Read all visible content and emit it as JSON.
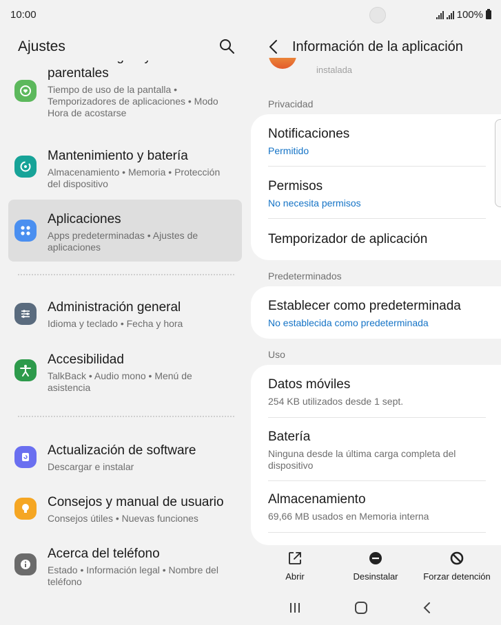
{
  "status_bar": {
    "time": "10:00",
    "battery": "100%"
  },
  "left_panel": {
    "title": "Ajustes",
    "items": [
      {
        "title": "parentales",
        "subtitle": "Tiempo de uso de la pantalla  •  Temporizadores de aplicaciones  •  Modo Hora de acostarse",
        "icon": "digital-wellbeing-icon",
        "color": "#5cb85c"
      },
      {
        "title": "Mantenimiento y batería",
        "subtitle": "Almacenamiento  •  Memoria  •  Protección del dispositivo",
        "icon": "device-care-icon",
        "color": "#17a398"
      },
      {
        "title": "Aplicaciones",
        "subtitle": "Apps predeterminadas  •  Ajustes de aplicaciones",
        "icon": "apps-icon",
        "color": "#4a8ff0"
      },
      {
        "title": "Administración general",
        "subtitle": "Idioma y teclado  •  Fecha y hora",
        "icon": "sliders-icon",
        "color": "#5a6b7e"
      },
      {
        "title": "Accesibilidad",
        "subtitle": "TalkBack  •  Audio mono  •  Menú de asistencia",
        "icon": "accessibility-icon",
        "color": "#2d9a4b"
      },
      {
        "title": "Actualización de software",
        "subtitle": "Descargar e instalar",
        "icon": "software-update-icon",
        "color": "#6a6ff0"
      },
      {
        "title": "Consejos y manual de usuario",
        "subtitle": "Consejos útiles  •  Nuevas funciones",
        "icon": "lightbulb-icon",
        "color": "#f5a623"
      },
      {
        "title": "Acerca del teléfono",
        "subtitle": "Estado  •  Información legal  •  Nombre del teléfono",
        "icon": "info-icon",
        "color": "#6b6b6b"
      }
    ]
  },
  "right_panel": {
    "title": "Información de la aplicación",
    "header_stub": "instalada",
    "sections": {
      "privacy": "Privacidad",
      "defaults": "Predeterminados",
      "usage": "Uso"
    },
    "privacy_rows": [
      {
        "title": "Notificaciones",
        "subtitle": "Permitido"
      },
      {
        "title": "Permisos",
        "subtitle": "No necesita permisos"
      },
      {
        "title": "Temporizador de aplicación"
      }
    ],
    "defaults_rows": [
      {
        "title": "Establecer como predeterminada",
        "subtitle": "No establecida como predeterminada"
      }
    ],
    "usage_rows": [
      {
        "title": "Datos móviles",
        "subtitle": "254 KB utilizados desde 1 sept."
      },
      {
        "title": "Batería",
        "subtitle": "Ninguna desde la última carga completa del dispositivo"
      },
      {
        "title": "Almacenamiento",
        "subtitle": "69,66 MB usados en Memoria interna"
      }
    ],
    "actions": {
      "open": "Abrir",
      "uninstall": "Desinstalar",
      "force_stop": "Forzar detención"
    }
  },
  "colors": {
    "accent_blue": "#1473c6",
    "background": "#f2f2f2",
    "card": "#ffffff",
    "selected": "#dedede"
  }
}
